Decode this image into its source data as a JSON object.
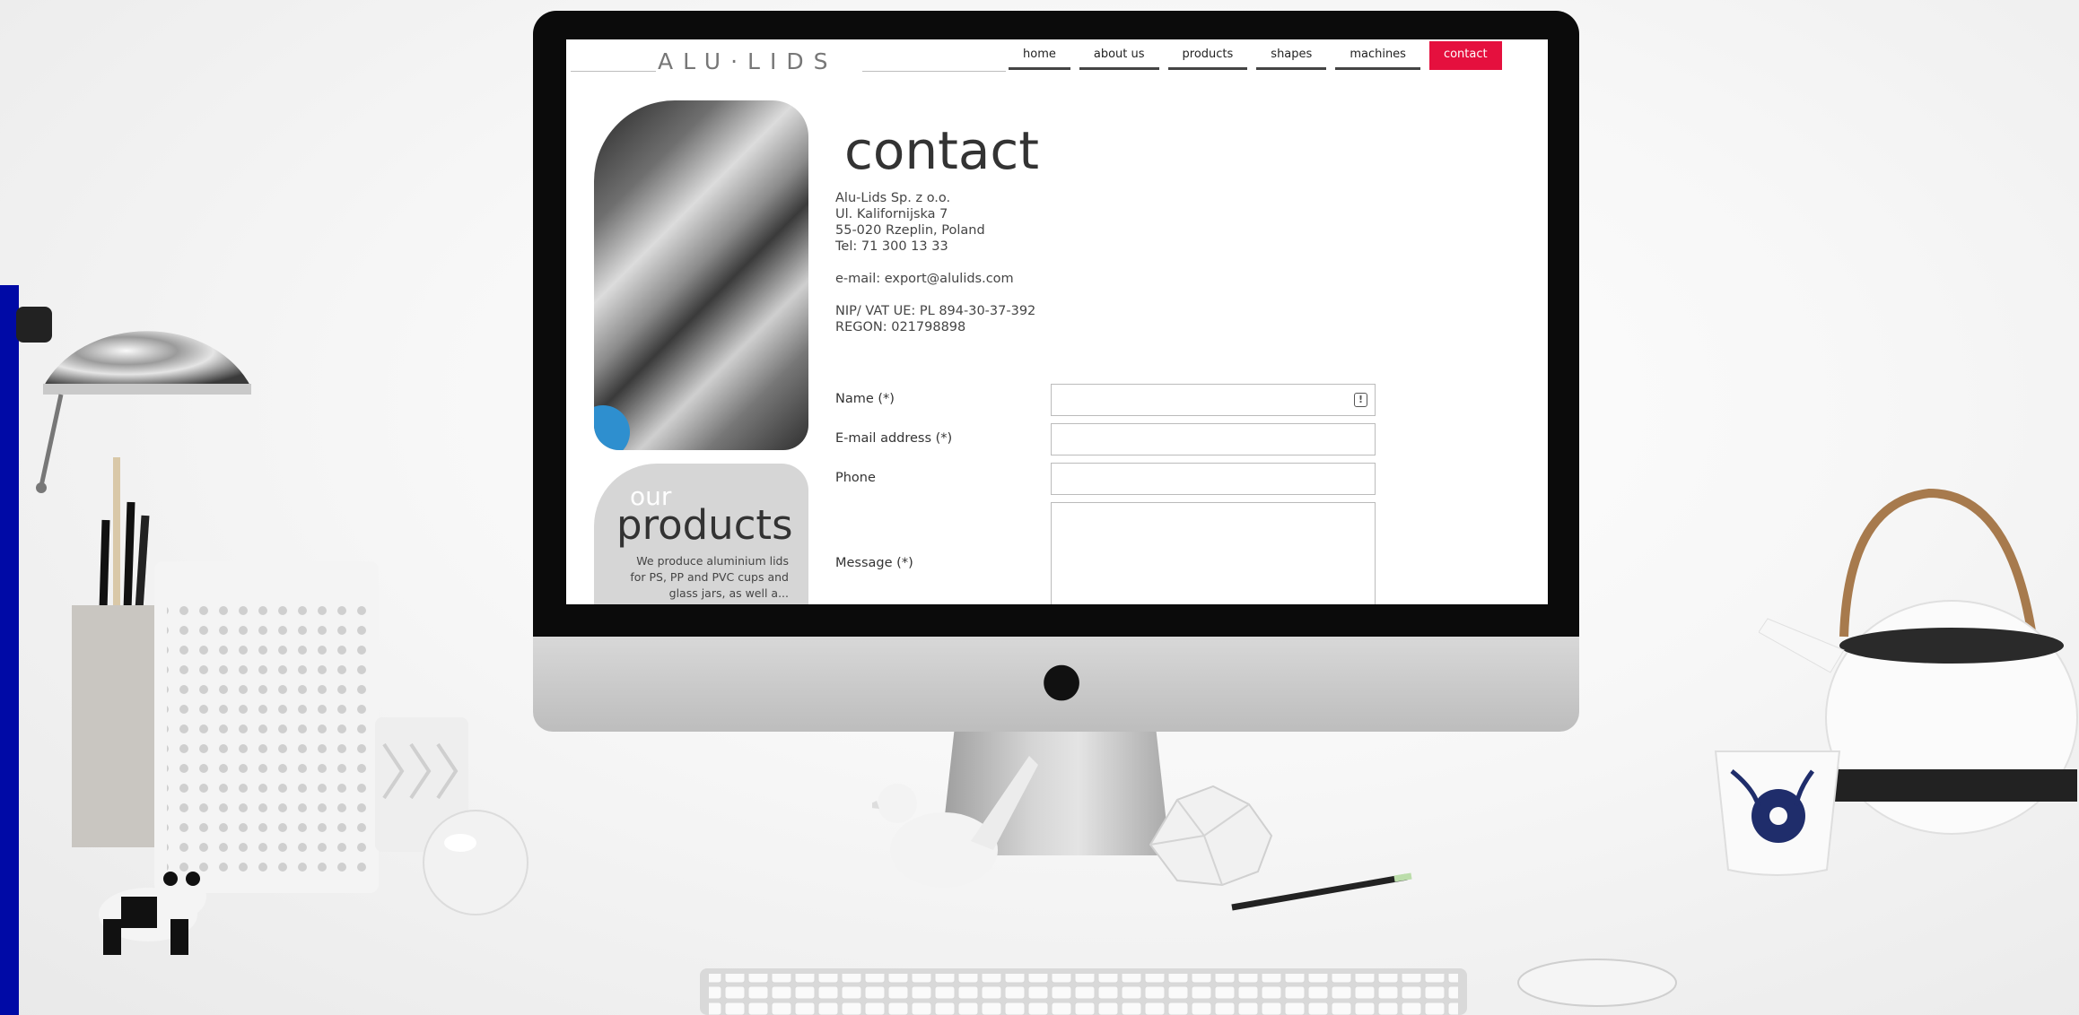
{
  "site": {
    "logo": "ALU·LIDS",
    "nav": [
      {
        "label": "home",
        "active": false
      },
      {
        "label": "about us",
        "active": false
      },
      {
        "label": "products",
        "active": false
      },
      {
        "label": "shapes",
        "active": false
      },
      {
        "label": "machines",
        "active": false
      },
      {
        "label": "contact",
        "active": true
      }
    ],
    "accent_color": "#e5103e",
    "products_box": {
      "our": "our",
      "title": "products",
      "description": "We produce aluminium lids for PS, PP and PVC cups and glass jars, as well a..."
    },
    "page_title": "contact",
    "address": [
      "Alu-Lids Sp. z o.o.",
      "Ul. Kalifornijska 7",
      "55-020 Rzeplin, Poland",
      "Tel: 71 300 13 33"
    ],
    "email_line": "e-mail: export@alulids.com",
    "ids": [
      "NIP/ VAT UE: PL 894-30-37-392",
      "REGON: 021798898"
    ],
    "form": {
      "name_label": "Name (*)",
      "email_label": "E-mail address (*)",
      "phone_label": "Phone",
      "message_label": "Message (*)",
      "name_value": "",
      "email_value": "",
      "phone_value": "",
      "message_value": ""
    }
  },
  "scene": {
    "apple_logo_icon": "apple-logo-icon",
    "strip_color": "#000aa6"
  }
}
